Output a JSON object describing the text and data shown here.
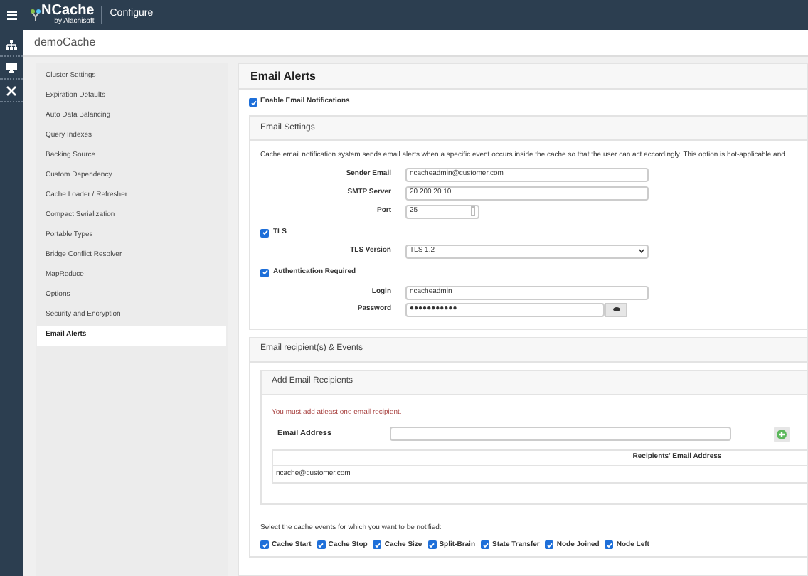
{
  "topbar": {
    "logo": "NCache",
    "logo_sub": "by Alachisoft",
    "title": "Configure"
  },
  "cache_name": "demoCache",
  "sidebar": {
    "items": [
      {
        "label": "Cluster Settings",
        "selected": false
      },
      {
        "label": "Expiration Defaults",
        "selected": false
      },
      {
        "label": "Auto Data Balancing",
        "selected": false
      },
      {
        "label": "Query Indexes",
        "selected": false
      },
      {
        "label": "Backing Source",
        "selected": false
      },
      {
        "label": "Custom Dependency",
        "selected": false
      },
      {
        "label": "Cache Loader / Refresher",
        "selected": false
      },
      {
        "label": "Compact Serialization",
        "selected": false
      },
      {
        "label": "Portable Types",
        "selected": false
      },
      {
        "label": "Bridge Conflict Resolver",
        "selected": false
      },
      {
        "label": "MapReduce",
        "selected": false
      },
      {
        "label": "Options",
        "selected": false
      },
      {
        "label": "Security and Encryption",
        "selected": false
      },
      {
        "label": "Email Alerts",
        "selected": true
      }
    ]
  },
  "page_title": "Email Alerts",
  "enable": {
    "label": "Enable Email Notifications",
    "checked": true
  },
  "email_settings": {
    "title": "Email Settings",
    "description": "Cache email notification system sends email alerts when a specific event occurs inside the cache so that the user can act accordingly. This option is hot-applicable and",
    "sender_email": {
      "label": "Sender Email",
      "value": "ncacheadmin@customer.com"
    },
    "smtp_server": {
      "label": "SMTP Server",
      "value": "20.200.20.10"
    },
    "port": {
      "label": "Port",
      "value": "25"
    },
    "tls": {
      "label": "TLS",
      "checked": true
    },
    "tls_version": {
      "label": "TLS Version",
      "value": "TLS 1.2"
    },
    "auth": {
      "label": "Authentication Required",
      "checked": true
    },
    "login": {
      "label": "Login",
      "value": "ncacheadmin"
    },
    "password": {
      "label": "Password",
      "value": "●●●●●●●●●●●"
    }
  },
  "recipients": {
    "title": "Email recipient(s) & Events",
    "add_title": "Add Email Recipients",
    "error": "You must add atleast one email recipient.",
    "email_label": "Email Address",
    "table": {
      "columns": [
        "Recipients' Email Address"
      ],
      "rows": [
        [
          "ncache@customer.com"
        ]
      ]
    },
    "events_prompt": "Select the cache events for which you want to be notified:",
    "events": [
      {
        "label": "Cache Start",
        "checked": true
      },
      {
        "label": "Cache Stop",
        "checked": true
      },
      {
        "label": "Cache Size",
        "checked": true
      },
      {
        "label": "Split-Brain",
        "checked": true
      },
      {
        "label": "State Transfer",
        "checked": true
      },
      {
        "label": "Node Joined",
        "checked": true
      },
      {
        "label": "Node Left",
        "checked": true
      }
    ]
  }
}
